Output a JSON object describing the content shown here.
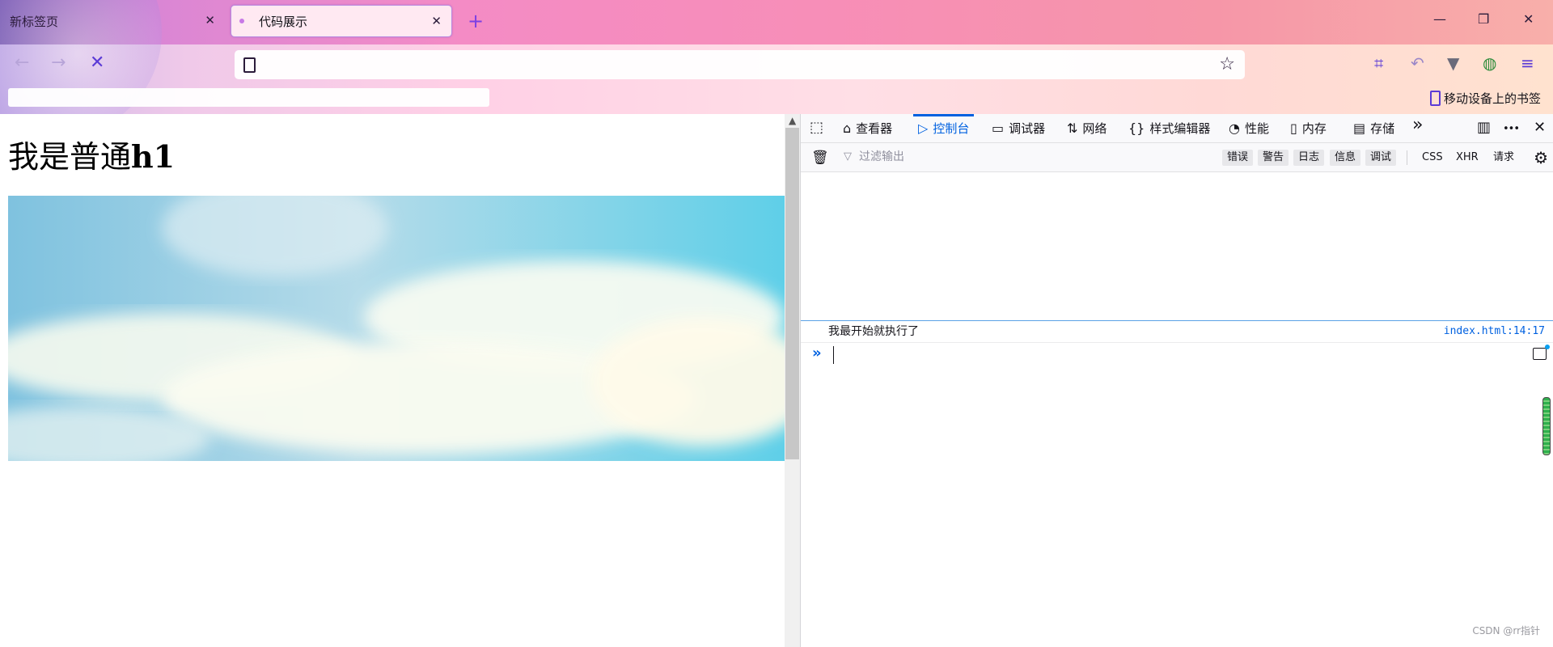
{
  "browser": {
    "tabs": [
      {
        "title": "新标签页",
        "active": false,
        "close": "✕"
      },
      {
        "title": "代码展示",
        "active": true,
        "close": "✕"
      }
    ],
    "new_tab": "+",
    "window_controls": {
      "minimize": "—",
      "restore": "❐",
      "close": "✕"
    },
    "nav": {
      "back": "←",
      "forward": "→",
      "stop": "✕"
    },
    "url": "",
    "star": "☆",
    "toolbar_icons": {
      "crop": "⌗",
      "undo": "↶",
      "vue": "▼",
      "globe": "◍",
      "menu": "≡"
    },
    "bookmarks": {
      "mobile_label": "移动设备上的书签"
    }
  },
  "page": {
    "h1_prefix": "我是普通",
    "h1_suffix": "h1"
  },
  "devtools": {
    "tabs": [
      {
        "icon": "⌂",
        "label": "查看器"
      },
      {
        "icon": "▷",
        "label": "控制台"
      },
      {
        "icon": "▭",
        "label": "调试器"
      },
      {
        "icon": "⇅",
        "label": "网络"
      },
      {
        "icon": "{}",
        "label": "样式编辑器"
      },
      {
        "icon": "◔",
        "label": "性能"
      },
      {
        "icon": "▯",
        "label": "内存"
      },
      {
        "icon": "▤",
        "label": "存储"
      }
    ],
    "more": "»",
    "pick_icon": "⬚",
    "filter_placeholder": "过滤输出",
    "levels": [
      "错误",
      "警告",
      "日志",
      "信息",
      "调试"
    ],
    "requests": [
      "CSS",
      "XHR",
      "请求"
    ],
    "messages": [
      {
        "text": "我最开始就执行了",
        "location": "index.html:14:17"
      }
    ],
    "prompt": "»",
    "right_icons": {
      "dock": "▥",
      "more": "•••",
      "close": "✕"
    }
  },
  "watermark": "CSDN @rr指针",
  "colors": {
    "accent": "#0061e0",
    "tab_accent": "#7b3fe4"
  }
}
